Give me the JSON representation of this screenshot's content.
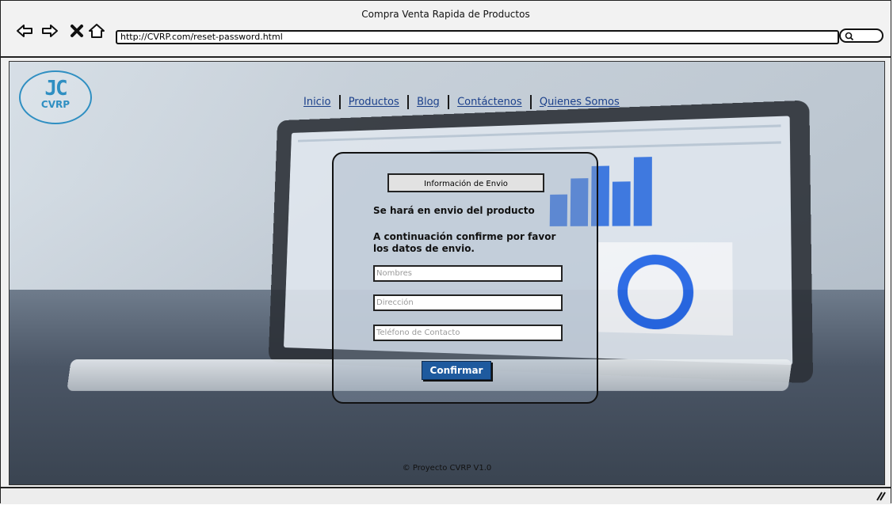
{
  "window": {
    "title": "Compra Venta Rapida de Productos",
    "url": "http://CVRP.com/reset-password.html",
    "icons": [
      "back-arrow-icon",
      "forward-arrow-icon",
      "close-x-icon",
      "home-icon",
      "search-icon",
      "resize-grip-icon"
    ]
  },
  "logo": {
    "mark": "JC",
    "text": "CVRP"
  },
  "nav": {
    "items": [
      "Inicio",
      "Productos",
      "Blog",
      "Contáctenos",
      "Quienes Somos"
    ]
  },
  "form": {
    "title": "Información de Envio",
    "message1": "Se hará en envio del producto",
    "message2": "A continuación confirme por favor los datos de envio.",
    "fields": {
      "nombres": "Nombres",
      "direccion": "Dirección",
      "telefono": "Teléfono de Contacto"
    },
    "submit_label": "Confirmar"
  },
  "footer": {
    "text": "© Proyecto CVRP V1.0"
  },
  "colors": {
    "accent": "#1e5a9e",
    "logo": "#2f8fc2",
    "link": "#1a3f8a"
  }
}
